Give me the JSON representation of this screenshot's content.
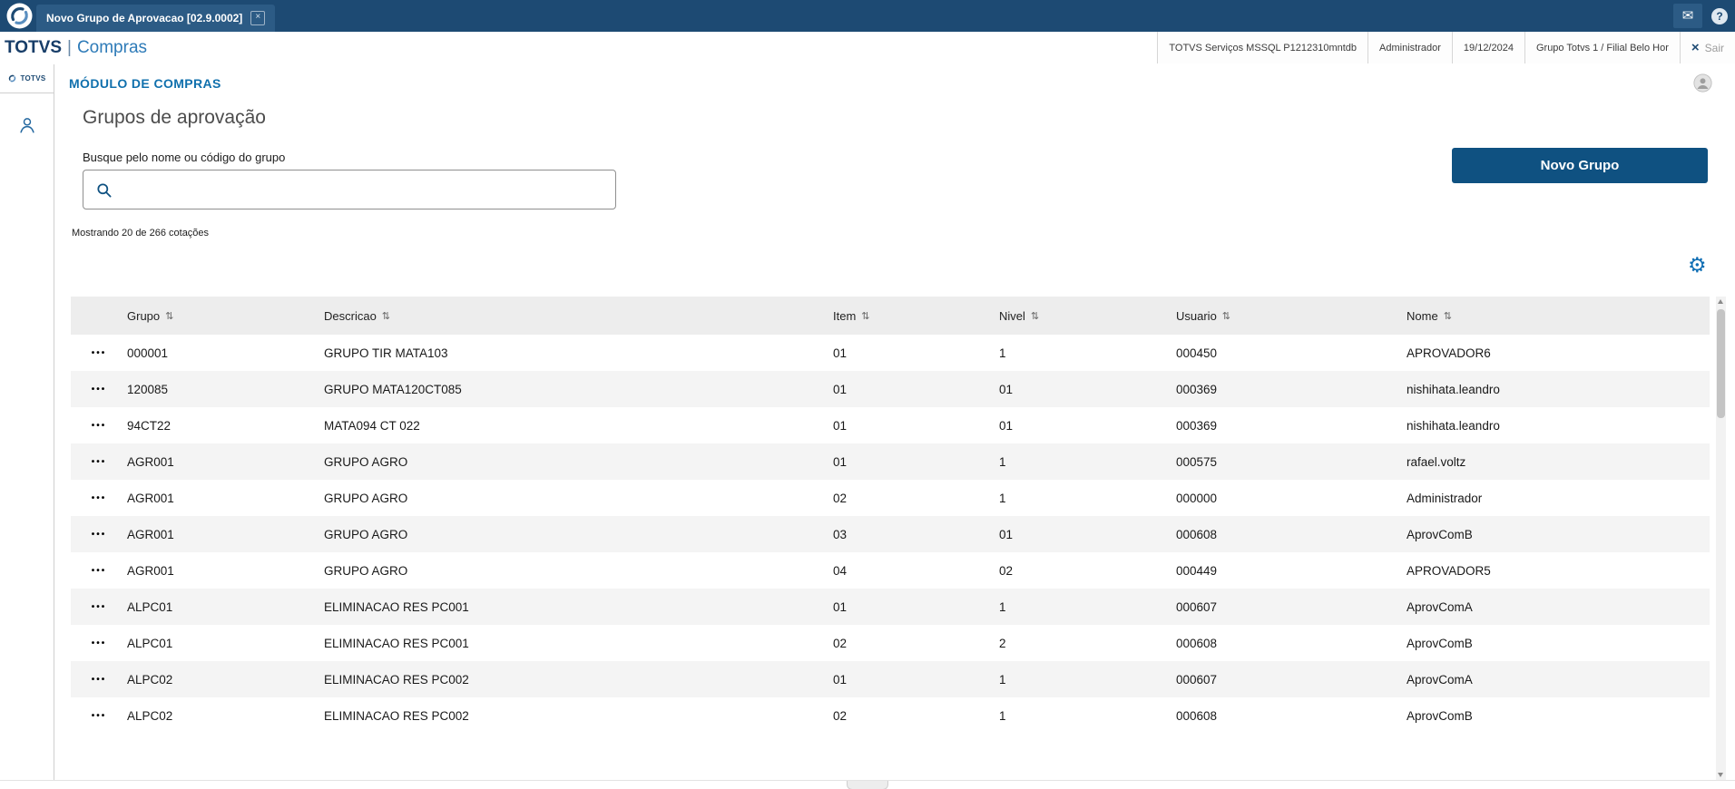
{
  "colors": {
    "topbar_bg": "#1d4a73",
    "accent_blue": "#1070ad",
    "button_bg": "#0f5181",
    "table_header_bg": "#ededed",
    "row_alt_bg": "#f4f4f4"
  },
  "icons": {
    "close": "×",
    "mail": "✉",
    "help": "?",
    "exit": "×",
    "sort": "⇅",
    "gear": "⚙",
    "dots": "•••"
  },
  "topbar": {
    "tab_label": "Novo Grupo de Aprovacao [02.9.0002]"
  },
  "header": {
    "brand_left": "TOTVS",
    "brand_sep": "|",
    "brand_right": "Compras",
    "environment": "TOTVS Serviços MSSQL P1212310mntdb",
    "user": "Administrador",
    "date": "19/12/2024",
    "company": "Grupo Totvs 1 / Filial Belo Hor",
    "exit_label": "Sair"
  },
  "sidebar": {
    "logo_text": "TOTVS"
  },
  "main": {
    "module_title": "MÓDULO DE COMPRAS",
    "page_title": "Grupos de aprovação",
    "search_label": "Busque pelo nome ou código do grupo",
    "search_value": "",
    "new_group_button": "Novo Grupo",
    "results_summary": "Mostrando 20 de 266 cotações"
  },
  "table": {
    "columns": [
      "Grupo",
      "Descricao",
      "Item",
      "Nivel",
      "Usuario",
      "Nome"
    ],
    "rows": [
      [
        "000001",
        "GRUPO TIR MATA103",
        "01",
        "1",
        "000450",
        "APROVADOR6"
      ],
      [
        "120085",
        "GRUPO MATA120CT085",
        "01",
        "01",
        "000369",
        "nishihata.leandro"
      ],
      [
        "94CT22",
        "MATA094 CT 022",
        "01",
        "01",
        "000369",
        "nishihata.leandro"
      ],
      [
        "AGR001",
        "GRUPO AGRO",
        "01",
        "1",
        "000575",
        "rafael.voltz"
      ],
      [
        "AGR001",
        "GRUPO AGRO",
        "02",
        "1",
        "000000",
        "Administrador"
      ],
      [
        "AGR001",
        "GRUPO AGRO",
        "03",
        "01",
        "000608",
        "AprovComB"
      ],
      [
        "AGR001",
        "GRUPO AGRO",
        "04",
        "02",
        "000449",
        "APROVADOR5"
      ],
      [
        "ALPC01",
        "ELIMINACAO RES PC001",
        "01",
        "1",
        "000607",
        "AprovComA"
      ],
      [
        "ALPC01",
        "ELIMINACAO RES PC001",
        "02",
        "2",
        "000608",
        "AprovComB"
      ],
      [
        "ALPC02",
        "ELIMINACAO RES PC002",
        "01",
        "1",
        "000607",
        "AprovComA"
      ],
      [
        "ALPC02",
        "ELIMINACAO RES PC002",
        "02",
        "1",
        "000608",
        "AprovComB"
      ]
    ]
  }
}
